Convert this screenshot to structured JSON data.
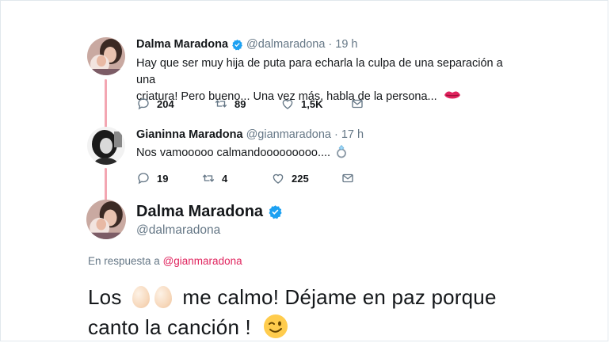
{
  "tweet1": {
    "name": "Dalma Maradona",
    "handle": "@dalmaradona",
    "time": "19 h",
    "text_line1": "Hay que ser muy hija de puta para echarla la culpa de una separación a una",
    "text_line2": "criatura! Pero bueno... Una vez más, habla de la persona...",
    "text_emoji": "lips-icon",
    "replies": "204",
    "retweets": "89",
    "likes": "1,5K"
  },
  "tweet2": {
    "name": "Gianinna Maradona",
    "handle": "@gianmaradona",
    "time": "17 h",
    "text": "Nos vamooooo calmandooooooooo....",
    "text_emoji": "ring-icon",
    "replies": "19",
    "retweets": "4",
    "likes": "225"
  },
  "main_tweet": {
    "name": "Dalma Maradona",
    "handle": "@dalmaradona",
    "reply_prefix": "En respuesta a",
    "reply_mention": "@gianmaradona",
    "text_part1": "Los",
    "text_part2": "me calmo! Déjame en paz porque",
    "text_line2": "canto la canción !",
    "emojis": [
      "egg-icon",
      "egg-icon",
      "winking-face-icon"
    ]
  },
  "colors": {
    "thread_line": "#f3a6b2",
    "verified": "#1da1f2",
    "secondary_text": "#657786",
    "mention": "#e0245e"
  }
}
